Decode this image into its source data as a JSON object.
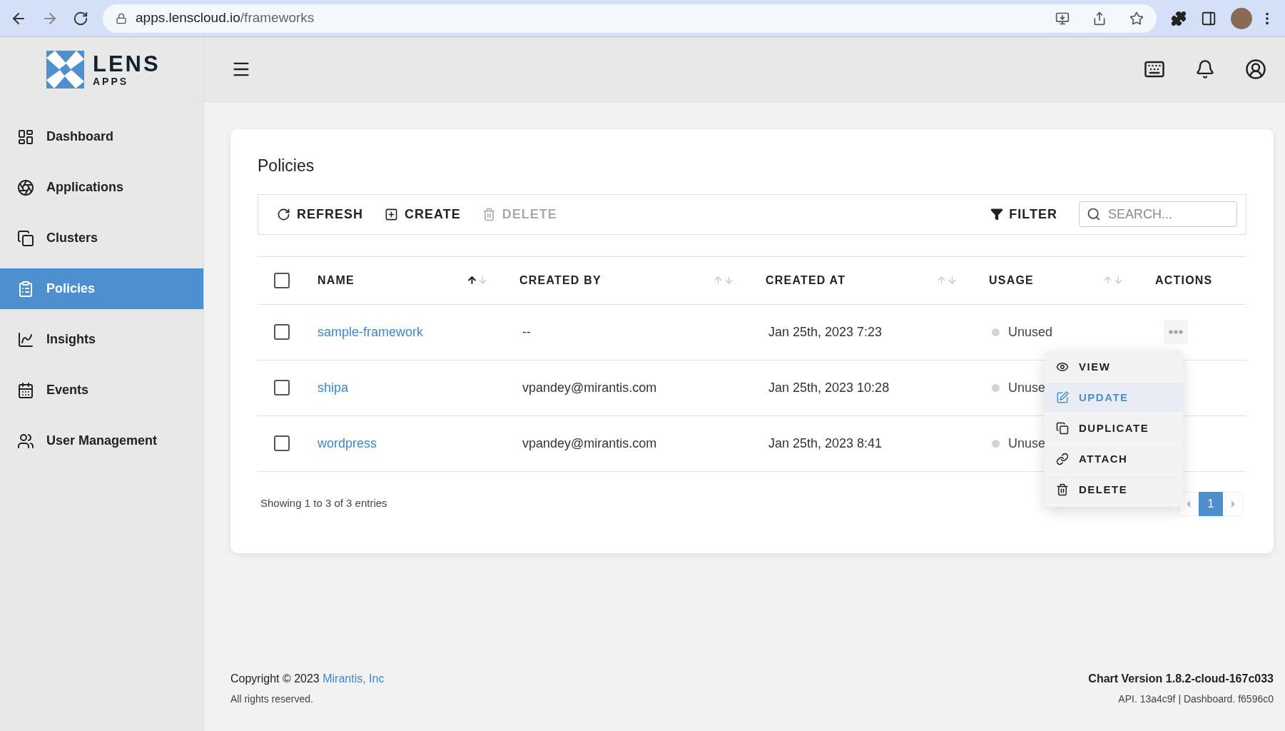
{
  "browser": {
    "url_host": "apps.lenscloud.io",
    "url_path": "/frameworks"
  },
  "logo": {
    "title": "LENS",
    "subtitle": "APPS"
  },
  "sidebar": {
    "items": [
      {
        "label": "Dashboard",
        "selected": false
      },
      {
        "label": "Applications",
        "selected": false
      },
      {
        "label": "Clusters",
        "selected": false
      },
      {
        "label": "Policies",
        "selected": true
      },
      {
        "label": "Insights",
        "selected": false
      },
      {
        "label": "Events",
        "selected": false
      },
      {
        "label": "User Management",
        "selected": false
      }
    ]
  },
  "page": {
    "title": "Policies"
  },
  "toolbar": {
    "buttons": [
      {
        "label": "REFRESH",
        "disabled": false
      },
      {
        "label": "CREATE",
        "disabled": false
      },
      {
        "label": "DELETE",
        "disabled": true
      }
    ],
    "filter": "FILTER",
    "search": {
      "placeholder": "SEARCH..."
    }
  },
  "table": {
    "header_checked": false,
    "columns": [
      {
        "label": "NAME",
        "sortable": true,
        "sort_active": true
      },
      {
        "label": "CREATED BY",
        "sortable": true,
        "sort_active": false
      },
      {
        "label": "CREATED AT",
        "sortable": true,
        "sort_active": false
      },
      {
        "label": "USAGE",
        "sortable": true,
        "sort_active": false
      },
      {
        "label": "ACTIONS",
        "sortable": false
      }
    ],
    "rows": [
      {
        "checked": false,
        "name": "sample-framework",
        "created_by": "--",
        "created_at": "Jan 25th, 2023 7:23",
        "usage": "Unused"
      },
      {
        "checked": false,
        "name": "shipa",
        "created_by": "vpandey@mirantis.com",
        "created_at": "Jan 25th, 2023 10:28",
        "usage": "Unuse"
      },
      {
        "checked": false,
        "name": "wordpress",
        "created_by": "vpandey@mirantis.com",
        "created_at": "Jan 25th, 2023 8:41",
        "usage": "Unuse"
      }
    ],
    "summary": "Showing 1 to 3 of 3 entries"
  },
  "action_menu": {
    "items": [
      {
        "label": "VIEW",
        "selected": false
      },
      {
        "label": "UPDATE",
        "selected": true
      },
      {
        "label": "DUPLICATE",
        "selected": false
      },
      {
        "label": "ATTACH",
        "selected": false
      },
      {
        "label": "DELETE",
        "selected": false
      }
    ]
  },
  "pagination": {
    "pages": [
      {
        "label": "1",
        "selected": true
      }
    ]
  },
  "footer": {
    "copyright": "Copyright © 2023",
    "company": "Mirantis, Inc",
    "rights": "All rights reserved.",
    "chart_version": "Chart Version 1.8.2-cloud-167c033",
    "build": "API. 13a4c9f | Dashboard. f6596c0"
  }
}
